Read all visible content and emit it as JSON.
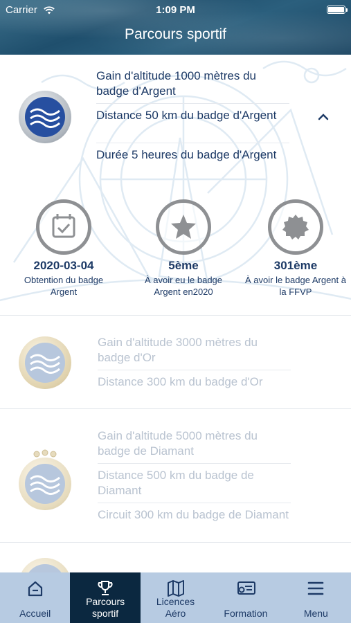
{
  "status_bar": {
    "carrier": "Carrier",
    "time": "1:09 PM"
  },
  "header": {
    "title": "Parcours sportif"
  },
  "cards": [
    {
      "badge": "argent-badge-icon",
      "items": [
        "Gain d'altitude 1000 mètres du badge d'Argent",
        "Distance 50 km du badge d'Argent",
        "Durée 5 heures du badge d'Argent"
      ],
      "expanded": true
    },
    {
      "badge": "or-badge-icon",
      "items": [
        "Gain d'altitude 3000 mètres du badge d'Or",
        "Distance 300 km du badge d'Or"
      ]
    },
    {
      "badge": "diamant-badge-icon",
      "items": [
        "Gain d'altitude 5000 mètres du badge de Diamant",
        "Distance 500 km du badge de Diamant",
        "Circuit 300 km du badge de Diamant"
      ]
    }
  ],
  "stats": [
    {
      "icon": "calendar-check-icon",
      "value": "2020-03-04",
      "label": "Obtention du badge Argent"
    },
    {
      "icon": "star-icon",
      "value": "5ème",
      "label": "À avoir eu le badge Argent en2020"
    },
    {
      "icon": "seal-icon",
      "value": "301ème",
      "label": "À avoir le badge Argent à la FFVP"
    }
  ],
  "tabbar": {
    "active": "parcours",
    "tabs": [
      {
        "id": "accueil",
        "icon": "home-icon",
        "label": "Accueil"
      },
      {
        "id": "parcours",
        "icon": "trophy-icon",
        "label": "Parcours sportif"
      },
      {
        "id": "licences",
        "icon": "map-icon",
        "label": "Licences Aéro"
      },
      {
        "id": "formation",
        "icon": "certificate-icon",
        "label": "Formation"
      },
      {
        "id": "menu",
        "icon": "hamburger-menu-icon",
        "label": "Menu"
      }
    ]
  },
  "colors": {
    "primary_text": "#1d3a66",
    "faded_text": "#b9c3d0",
    "tabbar_bg": "#b7cbe2",
    "tab_active_bg": "#0b2840"
  }
}
